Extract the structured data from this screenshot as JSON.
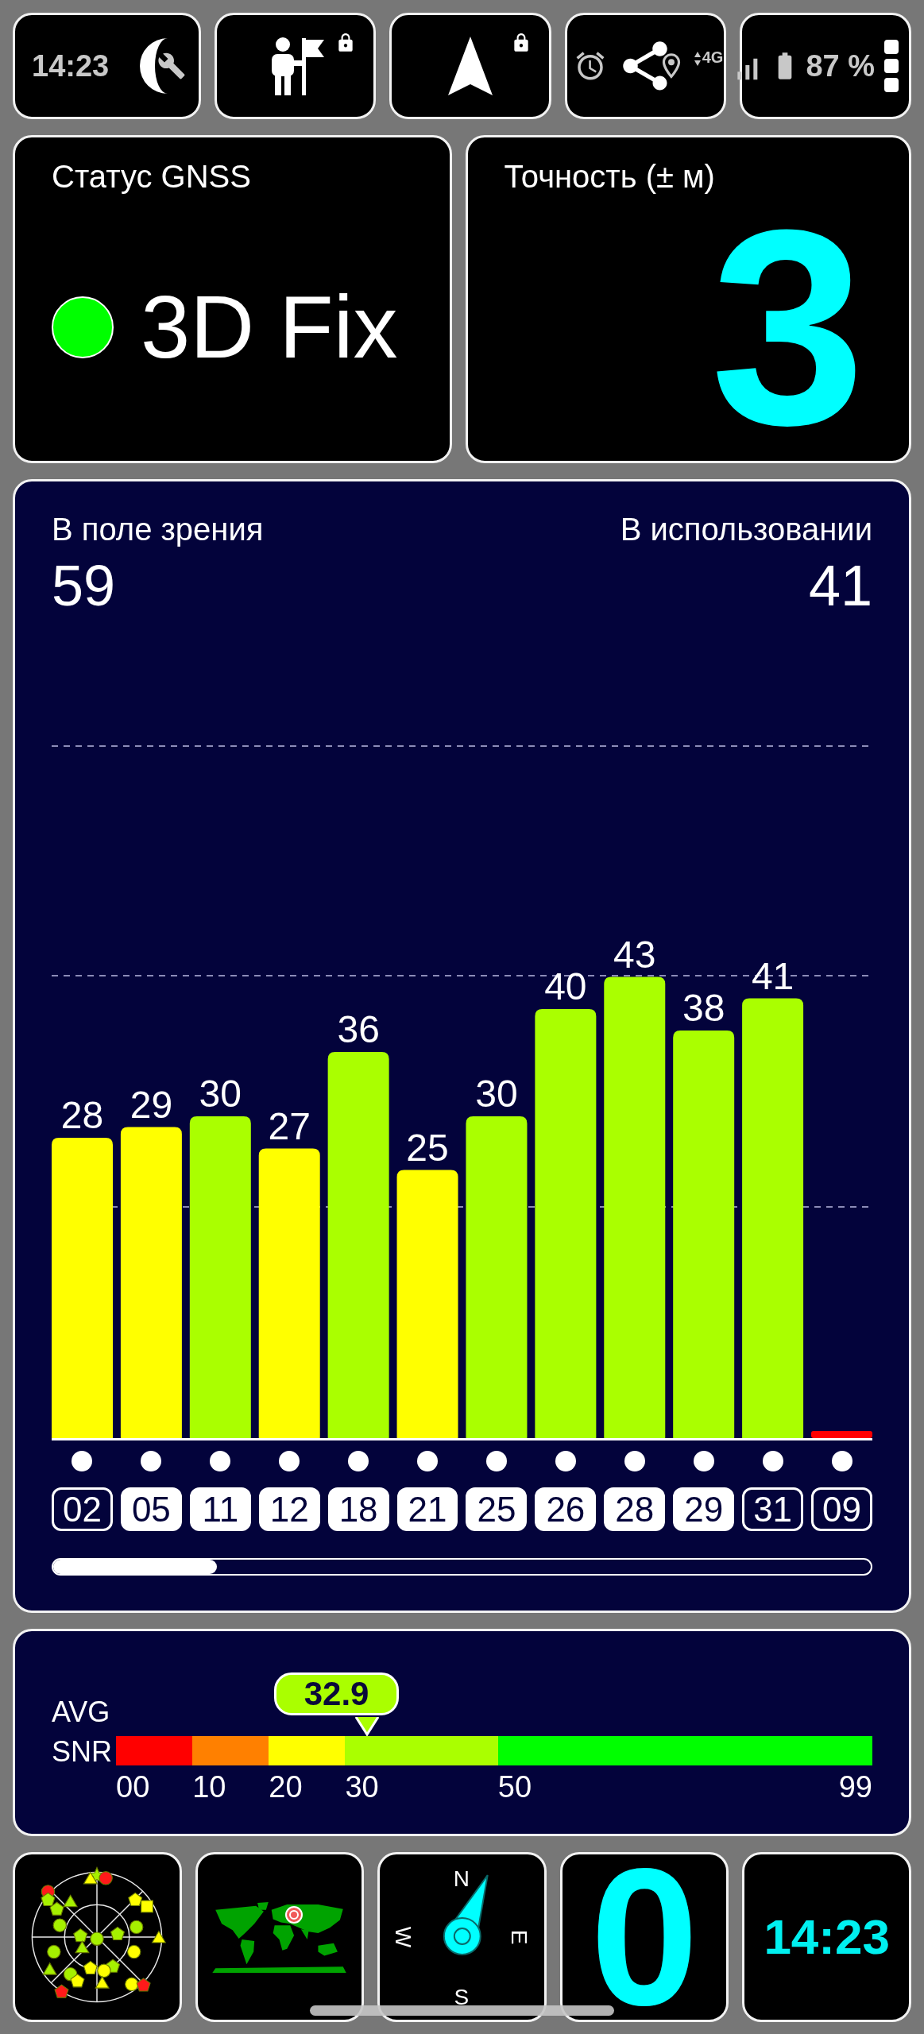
{
  "status_bar": {
    "time": "14:23",
    "network": "4G",
    "battery": "87 %"
  },
  "quick_tiles": [
    {
      "kind": "moon",
      "locked": false
    },
    {
      "kind": "explorer",
      "locked": true
    },
    {
      "kind": "navigation",
      "locked": true
    },
    {
      "kind": "share",
      "locked": false
    },
    {
      "kind": "handle",
      "locked": false
    }
  ],
  "gnss_status": {
    "title": "Статус GNSS",
    "fix": "3D Fix",
    "fixed": true
  },
  "accuracy": {
    "title": "Точность (± м)",
    "value": "3"
  },
  "satellites": {
    "in_view_label": "В поле зрения",
    "in_view": "59",
    "in_use_label": "В использовании",
    "in_use": "41",
    "chart_data": {
      "type": "bar",
      "categories": [
        "02",
        "05",
        "11",
        "12",
        "18",
        "21",
        "25",
        "26",
        "28",
        "29",
        "31",
        "09"
      ],
      "values": [
        28,
        29,
        30,
        27,
        36,
        25,
        30,
        40,
        43,
        38,
        41,
        0
      ],
      "value_labels": [
        "28",
        "29",
        "30",
        "27",
        "36",
        "25",
        "30",
        "40",
        "43",
        "38",
        "41",
        null
      ]
    },
    "ids": [
      {
        "used": false
      },
      {
        "used": true
      },
      {
        "used": true
      },
      {
        "used": true
      },
      {
        "used": true
      },
      {
        "used": true
      },
      {
        "used": true
      },
      {
        "used": true
      },
      {
        "used": true
      },
      {
        "used": true
      },
      {
        "used": false
      },
      {
        "used": false
      }
    ]
  },
  "snr": {
    "label_top": "AVG",
    "label_bottom": "SNR",
    "ticks": [
      "00",
      "10",
      "20",
      "30",
      "50",
      "99"
    ],
    "segments": [
      {
        "color": "#ff0000"
      },
      {
        "color": "#ff8000"
      },
      {
        "color": "#ffff00"
      },
      {
        "color": "#aaff00"
      },
      {
        "color": "#00ff00"
      }
    ],
    "average": {
      "reading": "32.9",
      "level": 0.332
    }
  },
  "bottom_tiles": [
    {
      "kind": "skyplot"
    },
    {
      "kind": "map"
    },
    {
      "kind": "compass",
      "north": "N",
      "east": "E",
      "south": "S",
      "west": "W"
    },
    {
      "kind": "number",
      "text": "0"
    },
    {
      "kind": "clock",
      "text": "14:23"
    }
  ]
}
